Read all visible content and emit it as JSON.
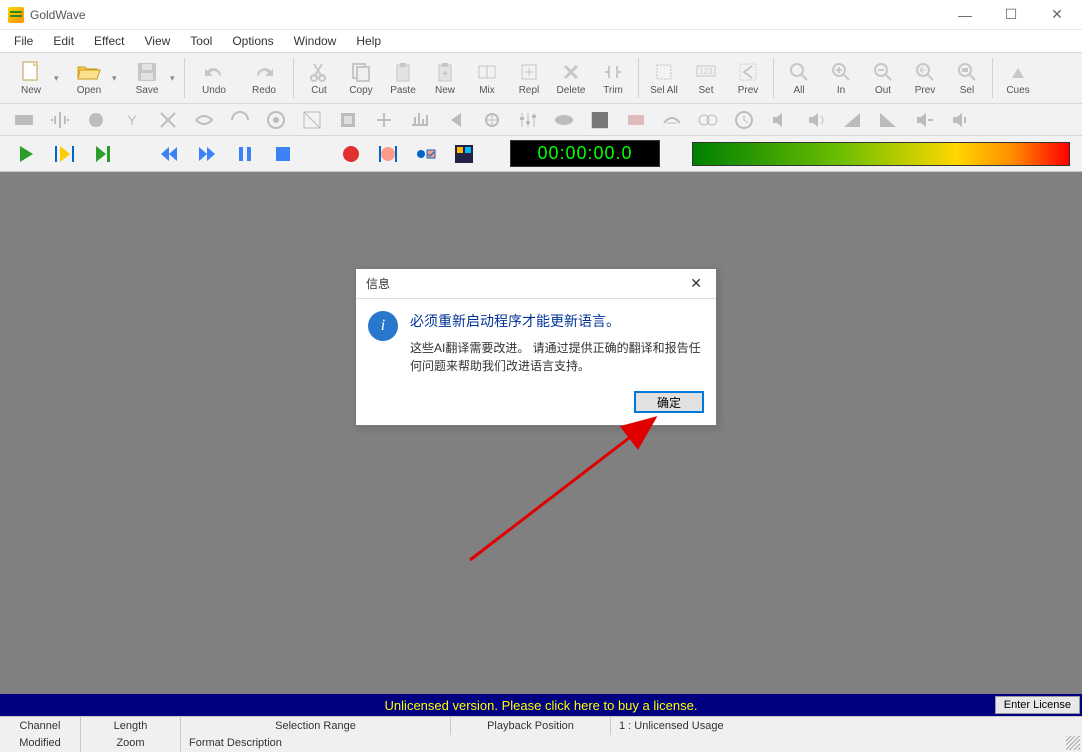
{
  "window": {
    "title": "GoldWave"
  },
  "menu": {
    "file": "File",
    "edit": "Edit",
    "effect": "Effect",
    "view": "View",
    "tool": "Tool",
    "options": "Options",
    "window": "Window",
    "help": "Help"
  },
  "toolbar": {
    "new": "New",
    "open": "Open",
    "save": "Save",
    "undo": "Undo",
    "redo": "Redo",
    "cut": "Cut",
    "copy": "Copy",
    "paste": "Paste",
    "tnew": "New",
    "mix": "Mix",
    "repl": "Repl",
    "delete": "Delete",
    "trim": "Trim",
    "selall": "Sel All",
    "set": "Set",
    "prev": "Prev",
    "all": "All",
    "in": "In",
    "out": "Out",
    "zprev": "Prev",
    "sel": "Sel",
    "cues": "Cues"
  },
  "transport": {
    "timer": "00:00:00.0"
  },
  "dialog": {
    "title": "信息",
    "heading": "必须重新启动程序才能更新语言。",
    "body": "这些AI翻译需要改进。 请通过提供正确的翻译和报告任何问题来帮助我们改进语言支持。",
    "ok": "确定"
  },
  "license": {
    "banner": "Unlicensed version. Please click here to buy a license.",
    "enter": "Enter License"
  },
  "status": {
    "channel": "Channel",
    "length": "Length",
    "selrange": "Selection Range",
    "playpos": "Playback Position",
    "unlic": "1 : Unlicensed Usage",
    "modified": "Modified",
    "zoom": "Zoom",
    "format": "Format Description"
  }
}
